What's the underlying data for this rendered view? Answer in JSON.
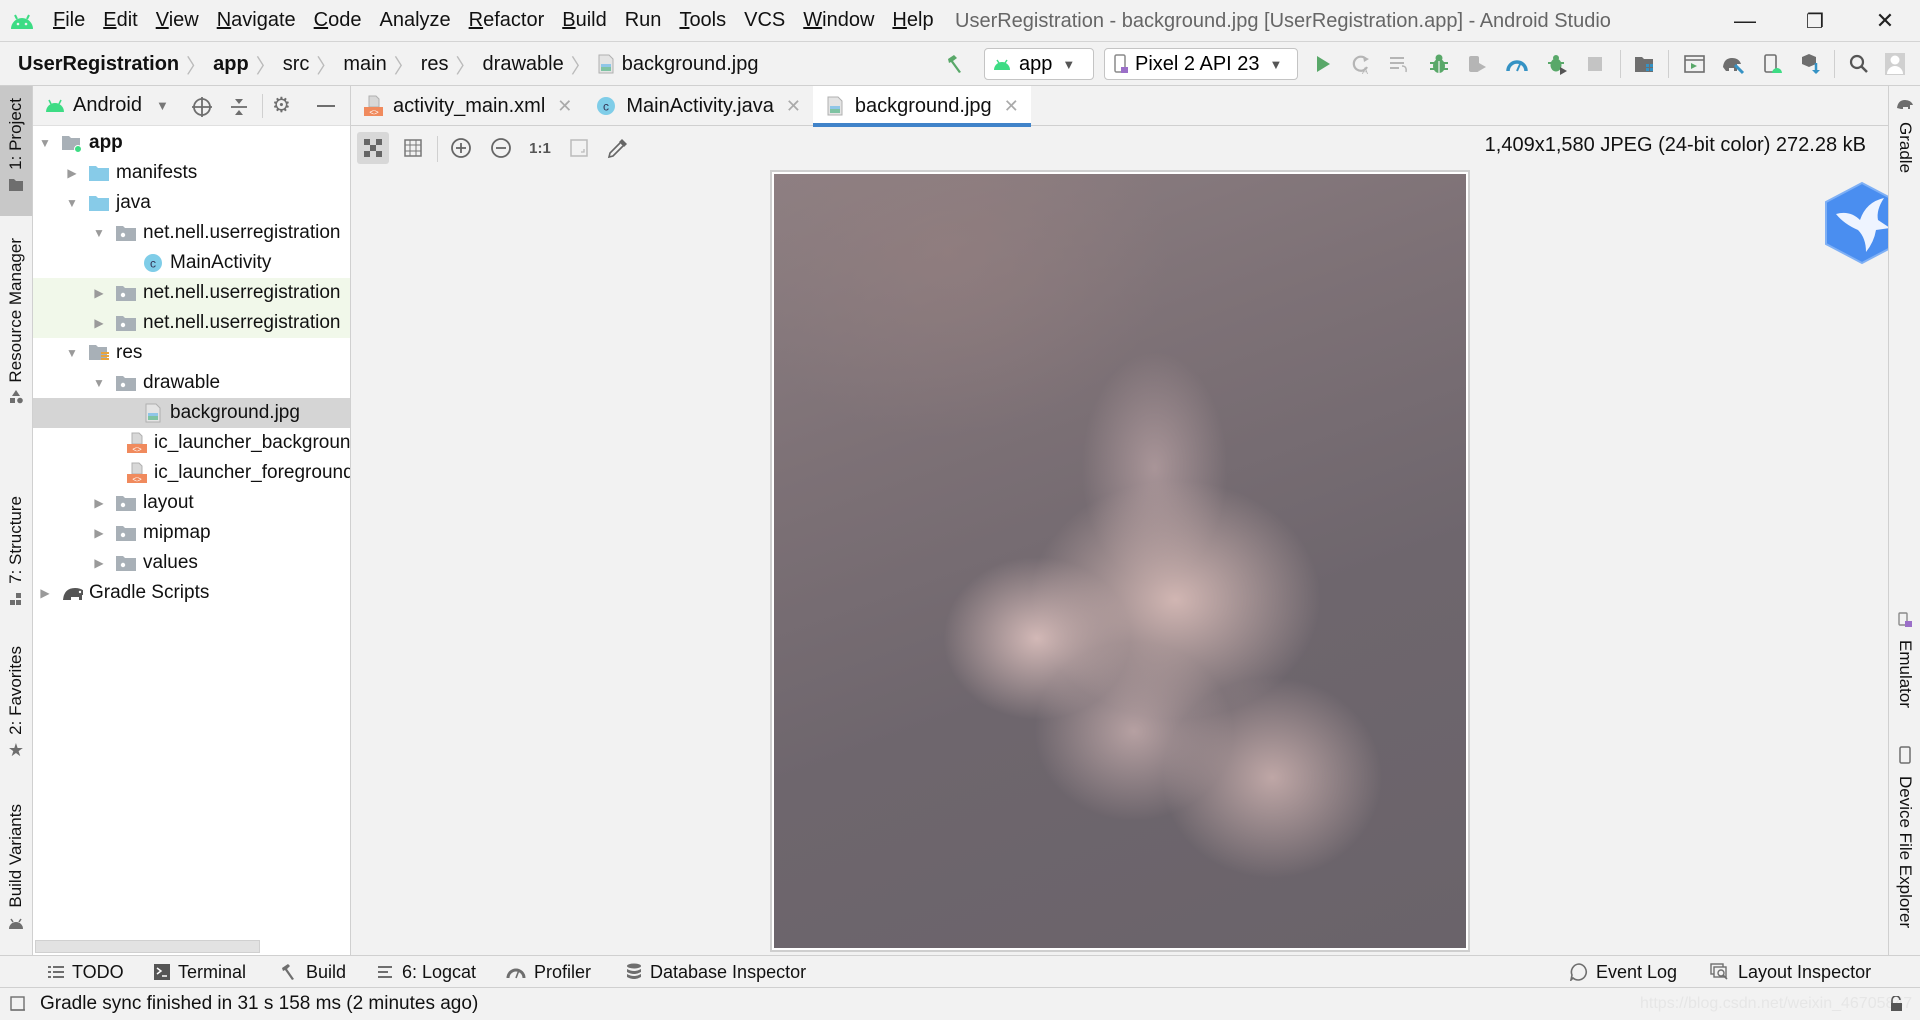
{
  "menubar": {
    "items": [
      {
        "label": "File",
        "mnemonic": "F",
        "rest": "ile"
      },
      {
        "label": "Edit",
        "mnemonic": "E",
        "rest": "dit"
      },
      {
        "label": "View",
        "mnemonic": "V",
        "rest": "iew"
      },
      {
        "label": "Navigate",
        "mnemonic": "N",
        "rest": "avigate"
      },
      {
        "label": "Code",
        "mnemonic": "C",
        "rest": "ode"
      },
      {
        "label": "Analyze",
        "mnemonic": "",
        "rest": "Analyze"
      },
      {
        "label": "Refactor",
        "mnemonic": "R",
        "rest": "efactor"
      },
      {
        "label": "Build",
        "mnemonic": "B",
        "rest": "uild"
      },
      {
        "label": "Run",
        "mnemonic": "",
        "rest": "Run"
      },
      {
        "label": "Tools",
        "mnemonic": "T",
        "rest": "ools"
      },
      {
        "label": "VCS",
        "mnemonic": "",
        "rest": "VCS"
      },
      {
        "label": "Window",
        "mnemonic": "W",
        "rest": "indow"
      },
      {
        "label": "Help",
        "mnemonic": "H",
        "rest": "elp"
      }
    ],
    "window_title": "UserRegistration - background.jpg [UserRegistration.app] - Android Studio",
    "minimize": "—",
    "restore": "❐",
    "close": "✕"
  },
  "breadcrumbs": [
    "UserRegistration",
    "app",
    "src",
    "main",
    "res",
    "drawable",
    "background.jpg"
  ],
  "toolbar": {
    "run_config": "app",
    "device": "Pixel 2 API 23"
  },
  "project_panel": {
    "view": "Android",
    "tree": [
      {
        "label": "app",
        "depth": 0,
        "toggle": "open",
        "icon": "module-folder",
        "bold": true
      },
      {
        "label": "manifests",
        "depth": 1,
        "toggle": "closed",
        "icon": "folder-blue"
      },
      {
        "label": "java",
        "depth": 1,
        "toggle": "open",
        "icon": "folder-blue"
      },
      {
        "label": "net.nell.userregistration",
        "depth": 2,
        "toggle": "open",
        "icon": "package"
      },
      {
        "label": "MainActivity",
        "depth": 3,
        "toggle": "none",
        "icon": "class"
      },
      {
        "label": "net.nell.userregistration",
        "depth": 2,
        "toggle": "closed",
        "icon": "package",
        "tinted": true
      },
      {
        "label": "net.nell.userregistration",
        "depth": 2,
        "toggle": "closed",
        "icon": "package",
        "tinted": true
      },
      {
        "label": "res",
        "depth": 1,
        "toggle": "open",
        "icon": "res-folder"
      },
      {
        "label": "drawable",
        "depth": 2,
        "toggle": "open",
        "icon": "package"
      },
      {
        "label": "background.jpg",
        "depth": 3,
        "toggle": "none",
        "icon": "image-file",
        "selected": true
      },
      {
        "label": "ic_launcher_background.xml",
        "depth": 3,
        "toggle": "none",
        "icon": "xml-file"
      },
      {
        "label": "ic_launcher_foreground.xml",
        "depth": 3,
        "toggle": "none",
        "icon": "xml-file"
      },
      {
        "label": "layout",
        "depth": 2,
        "toggle": "closed",
        "icon": "package"
      },
      {
        "label": "mipmap",
        "depth": 2,
        "toggle": "closed",
        "icon": "package"
      },
      {
        "label": "values",
        "depth": 2,
        "toggle": "closed",
        "icon": "package"
      },
      {
        "label": "Gradle Scripts",
        "depth": 0,
        "toggle": "closed",
        "icon": "gradle"
      }
    ]
  },
  "left_strip": {
    "project": "1: Project",
    "resource_manager": "Resource Manager",
    "structure": "7: Structure",
    "favorites": "2: Favorites",
    "build_variants": "Build Variants"
  },
  "right_strip": {
    "gradle": "Gradle",
    "emulator": "Emulator",
    "device_file_explorer": "Device File Explorer"
  },
  "editor": {
    "tabs": [
      {
        "label": "activity_main.xml",
        "icon": "xml-file",
        "active": false
      },
      {
        "label": "MainActivity.java",
        "icon": "class",
        "active": false
      },
      {
        "label": "background.jpg",
        "icon": "image-file",
        "active": true
      }
    ],
    "image_toolbar": {
      "actual_size": "1:1"
    },
    "image_info": "1,409x1,580 JPEG (24-bit color) 272.28 kB"
  },
  "bottom_bar": {
    "left": [
      {
        "label": "TODO",
        "icon": "list-icon"
      },
      {
        "label": "Terminal",
        "icon": "terminal-icon"
      },
      {
        "label": "Build",
        "icon": "hammer-icon"
      },
      {
        "label": "6: Logcat",
        "icon": "logcat-icon"
      },
      {
        "label": "Profiler",
        "icon": "gauge-icon"
      },
      {
        "label": "Database Inspector",
        "icon": "database-icon"
      }
    ],
    "right": [
      {
        "label": "Event Log",
        "icon": "balloon-icon"
      },
      {
        "label": "Layout Inspector",
        "icon": "layout-inspector-icon"
      }
    ]
  },
  "status": {
    "message": "Gradle sync finished in 31 s 158 ms (2 minutes ago)",
    "watermark": "https://blog.csdn.net/weixin_46705847"
  },
  "colors": {
    "accent": "#4083c9",
    "android_green": "#3ddc84",
    "run_green": "#59a869",
    "selection": "#d5d5d5"
  }
}
